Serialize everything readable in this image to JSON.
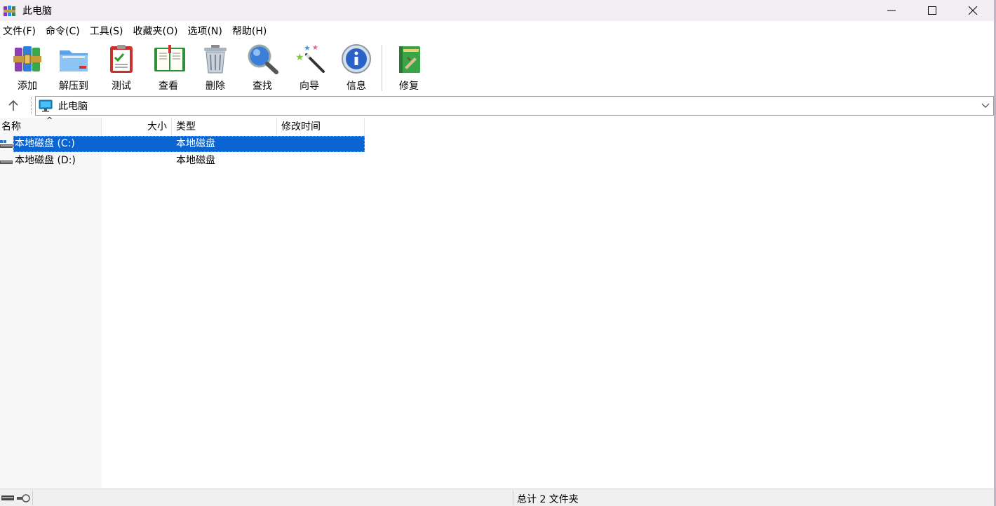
{
  "window": {
    "title": "此电脑"
  },
  "menu": [
    "文件(F)",
    "命令(C)",
    "工具(S)",
    "收藏夹(O)",
    "选项(N)",
    "帮助(H)"
  ],
  "toolbar": {
    "buttons": [
      {
        "label": "添加",
        "icon": "add-archive-icon"
      },
      {
        "label": "解压到",
        "icon": "extract-folder-icon"
      },
      {
        "label": "测试",
        "icon": "test-clipboard-icon"
      },
      {
        "label": "查看",
        "icon": "view-book-icon"
      },
      {
        "label": "删除",
        "icon": "trash-icon"
      },
      {
        "label": "查找",
        "icon": "find-magnifier-icon"
      },
      {
        "label": "向导",
        "icon": "wizard-wand-icon"
      },
      {
        "label": "信息",
        "icon": "info-icon"
      },
      {
        "label": "修复",
        "icon": "repair-book-icon"
      }
    ]
  },
  "address": {
    "path": "此电脑"
  },
  "columns": {
    "name": "名称",
    "size": "大小",
    "type": "类型",
    "modified": "修改时间"
  },
  "files": [
    {
      "name": "本地磁盘 (C:)",
      "size": "",
      "type": "本地磁盘",
      "modified": "",
      "selected": true
    },
    {
      "name": "本地磁盘 (D:)",
      "size": "",
      "type": "本地磁盘",
      "modified": "",
      "selected": false
    }
  ],
  "status": {
    "summary": "总计 2 文件夹"
  },
  "colors": {
    "selection": "#0a64d2",
    "titlebar": "#f3eef4"
  }
}
